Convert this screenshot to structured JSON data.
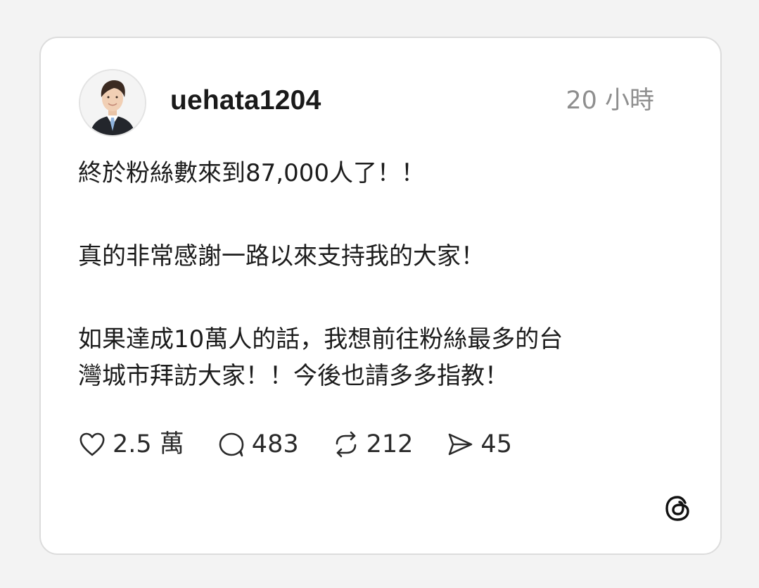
{
  "post": {
    "username": "uehata1204",
    "timestamp": "20 小時",
    "avatar_icon": "profile-photo",
    "body": [
      "終於粉絲數來到87,000人了！！",
      "真的非常感謝一路以來支持我的大家！",
      "如果達成10萬人的話，我想前往粉絲最多的台",
      "灣城市拜訪大家！！今後也請多多指教！"
    ],
    "stats": {
      "likes": "2.5 萬",
      "replies": "483",
      "reposts": "212",
      "shares": "45"
    },
    "brand_icon": "threads-logo"
  },
  "colors": {
    "card_background": "#ffffff",
    "card_border": "#dcdcdc",
    "text": "#1c1c1c",
    "muted_text": "#8e8e8e"
  }
}
